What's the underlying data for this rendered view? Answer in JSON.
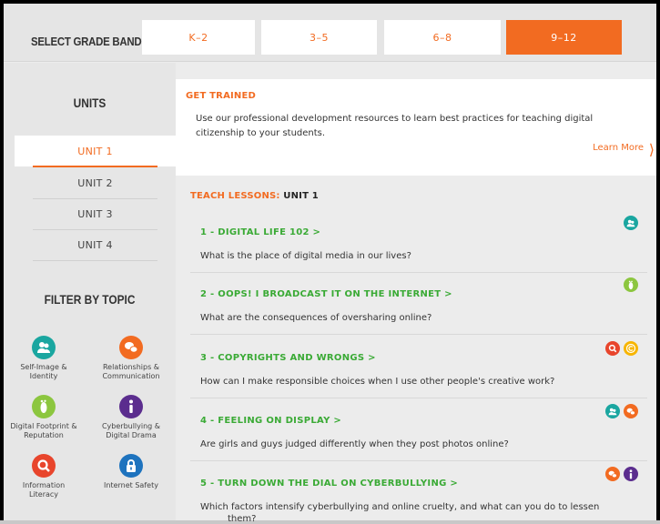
{
  "grade_band": {
    "label": "SELECT GRADE BAND",
    "options": [
      "K–2",
      "3–5",
      "6–8",
      "9–12"
    ],
    "selected": "9–12"
  },
  "sidebar": {
    "units_title": "UNITS",
    "units": [
      "UNIT 1",
      "UNIT 2",
      "UNIT 3",
      "UNIT 4"
    ],
    "selected_unit": "UNIT 1",
    "filter_title": "FILTER BY TOPIC",
    "topics": [
      {
        "label": "Self-Image & Identity",
        "icon": "people-icon",
        "color": "#1aa6a0"
      },
      {
        "label": "Relationships & Communication",
        "icon": "chat-bubbles-icon",
        "color": "#f26b21"
      },
      {
        "label": "Digital Footprint & Reputation",
        "icon": "footprint-icon",
        "color": "#8cc63f"
      },
      {
        "label": "Cyberbullying & Digital Drama",
        "icon": "exclamation-icon",
        "color": "#5b2d8e"
      },
      {
        "label": "Information Literacy",
        "icon": "magnifier-icon",
        "color": "#e8452c"
      },
      {
        "label": "Internet Safety",
        "icon": "lock-icon",
        "color": "#1e73be"
      }
    ]
  },
  "trained": {
    "title": "GET TRAINED",
    "text": "Use our professional development resources to learn best practices for teaching digital citizenship to your students.",
    "link": "Learn More",
    "arrow": "⟩"
  },
  "teach": {
    "prefix": "TEACH LESSONS: ",
    "unit": "UNIT 1"
  },
  "lessons": [
    {
      "title": "1 - DIGITAL LIFE 102 >",
      "desc": "What is the place of digital media in our lives?",
      "icons": [
        "people-icon"
      ]
    },
    {
      "title": "2 - OOPS! I BROADCAST IT ON THE INTERNET >",
      "desc": "What are the consequences of oversharing online?",
      "icons": [
        "footprint-icon"
      ]
    },
    {
      "title": "3 - COPYRIGHTS AND WRONGS >",
      "desc": "How can I make responsible choices when I use other people's creative work?",
      "icons": [
        "magnifier-icon",
        "copyright-icon"
      ]
    },
    {
      "title": "4 - FEELING ON DISPLAY >",
      "desc": "Are girls and guys judged differently when they post photos online?",
      "icons": [
        "people-icon",
        "chat-bubbles-icon"
      ]
    },
    {
      "title": "5 - TURN DOWN THE DIAL ON CYBERBULLYING >",
      "desc": "Which factors intensify cyberbullying and online cruelty, and what can you do to lessen",
      "icons": [
        "chat-bubbles-icon",
        "exclamation-icon"
      ]
    }
  ],
  "lesson5_continued": "them?",
  "colors": {
    "accent": "#f26b21",
    "lesson_title": "#3aaa35",
    "teal": "#1aa6a0",
    "green": "#8cc63f",
    "purple": "#5b2d8e",
    "red": "#e8452c",
    "blue": "#1e73be",
    "yellow": "#f7b500"
  }
}
